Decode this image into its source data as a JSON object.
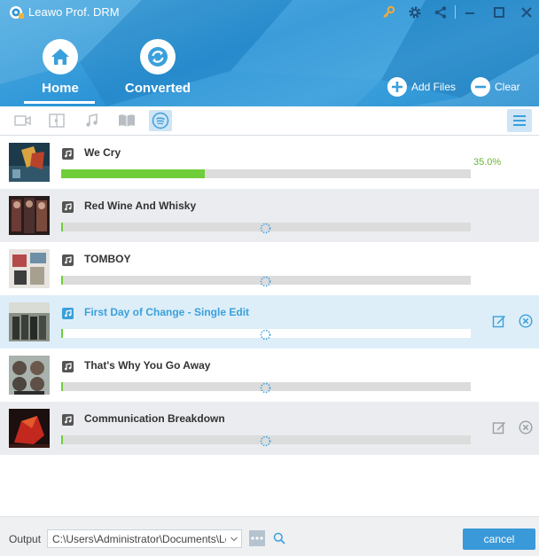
{
  "app": {
    "title": "Leawo Prof. DRM"
  },
  "titlebar": {
    "icons": [
      "key-icon",
      "gear-icon",
      "share-icon",
      "minimize-icon",
      "maximize-icon",
      "close-icon"
    ]
  },
  "nav": {
    "home_label": "Home",
    "converted_label": "Converted",
    "active": "Home"
  },
  "actions": {
    "add_files_label": "Add Files",
    "clear_label": "Clear"
  },
  "filters": [
    "video-icon",
    "ebook-icon",
    "music-icon",
    "book-icon",
    "spotify-icon"
  ],
  "filter_active": "spotify-icon",
  "colors": {
    "header": "#2b94d6",
    "accent": "#3aa0dc",
    "progress": "#6fce3a",
    "selected_row": "#ddeef8"
  },
  "songs": [
    {
      "title": "We Cry",
      "progress": 0.35,
      "percent_label": "35.0%",
      "status": "converting"
    },
    {
      "title": "Red Wine And Whisky",
      "progress": 0,
      "status": "waiting"
    },
    {
      "title": "TOMBOY",
      "progress": 0,
      "status": "waiting"
    },
    {
      "title": "First Day of Change - Single Edit",
      "progress": 0,
      "status": "waiting",
      "selected": true
    },
    {
      "title": "That's Why You Go Away",
      "progress": 0,
      "status": "waiting"
    },
    {
      "title": "Communication Breakdown",
      "progress": 0,
      "status": "waiting"
    }
  ],
  "footer": {
    "output_label": "Output",
    "output_path": "C:\\Users\\Administrator\\Documents\\Leawo",
    "cancel_label": "cancel"
  }
}
